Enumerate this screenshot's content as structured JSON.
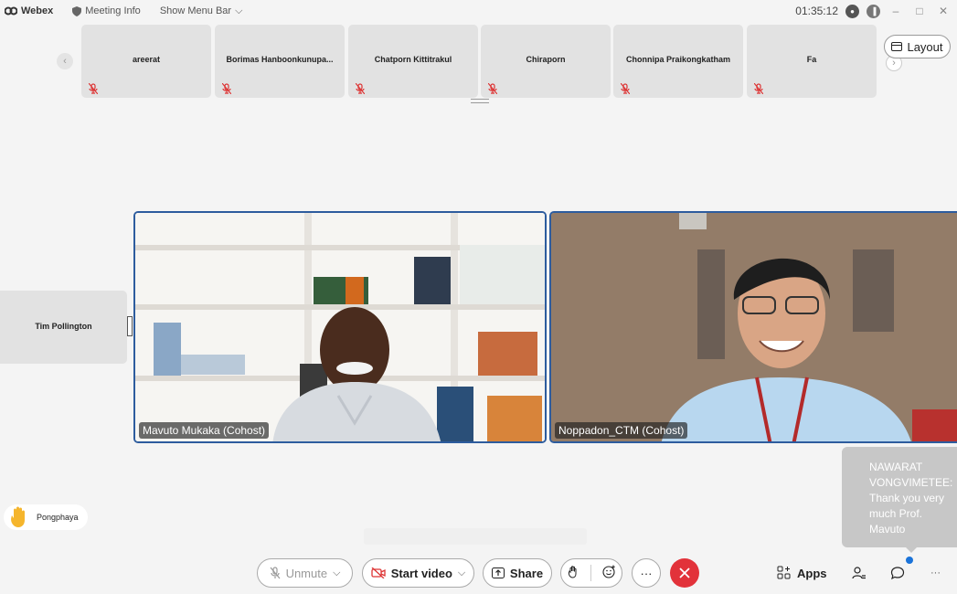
{
  "titlebar": {
    "app": "Webex",
    "meeting_info": "Meeting Info",
    "show_menu_bar": "Show Menu Bar",
    "clock": "01:35:12"
  },
  "participants_strip": [
    {
      "name": "areerat"
    },
    {
      "name": "Borimas Hanboonkunupa..."
    },
    {
      "name": "Chatporn Kittitrakul"
    },
    {
      "name": "Chiraporn"
    },
    {
      "name": "Chonnipa Praikongkatham"
    },
    {
      "name": "Fa"
    }
  ],
  "layout_button": "Layout",
  "side_tile": {
    "name": "Tim Pollington"
  },
  "videos": [
    {
      "label": "Mavuto Mukaka (Cohost)"
    },
    {
      "label": "Noppadon_CTM (Cohost)"
    }
  ],
  "raised_hand": {
    "name": "Pongphaya"
  },
  "chat_popup": {
    "text": "NAWARAT VONGVIMETEE: Thank you very much Prof. Mavuto"
  },
  "controls": {
    "unmute": "Unmute",
    "start_video": "Start video",
    "share": "Share",
    "apps": "Apps",
    "more": "···"
  },
  "colors": {
    "active_border": "#2d5c9e",
    "end_call": "#e2323a",
    "chat_dot": "#1a73d9"
  }
}
